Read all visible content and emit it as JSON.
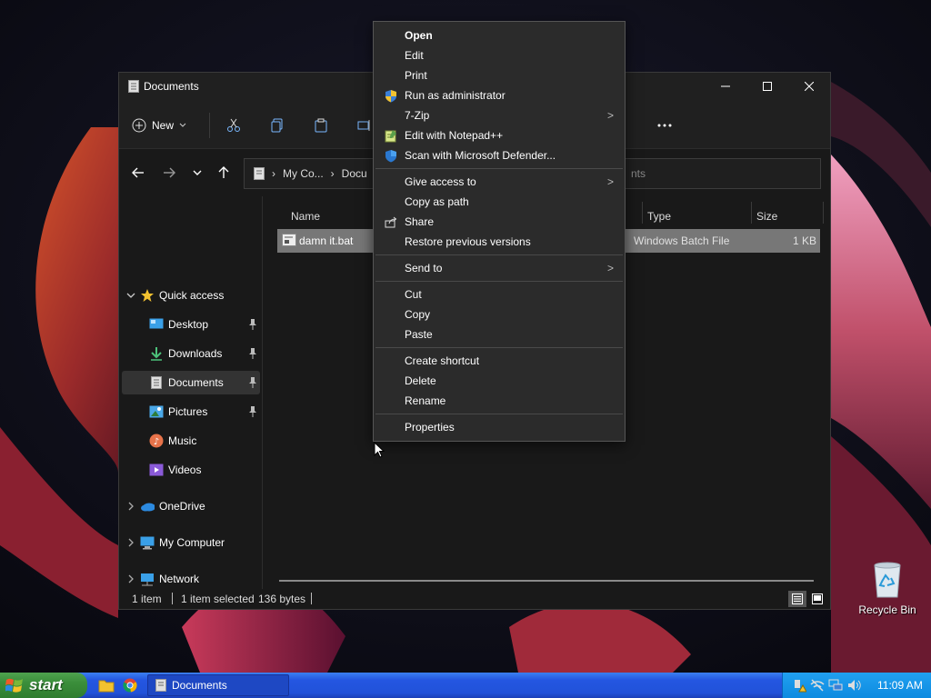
{
  "window": {
    "title": "Documents",
    "new_label": "New",
    "breadcrumb": [
      "My Co...",
      "Docu"
    ],
    "search_placeholder": "nts",
    "nav_items": [
      {
        "label": "Quick access",
        "icon": "star-icon"
      },
      {
        "label": "Desktop",
        "icon": "desktop-icon",
        "pinned": true
      },
      {
        "label": "Downloads",
        "icon": "download-icon",
        "pinned": true
      },
      {
        "label": "Documents",
        "icon": "document-icon",
        "pinned": true,
        "selected": true
      },
      {
        "label": "Pictures",
        "icon": "picture-icon",
        "pinned": true
      },
      {
        "label": "Music",
        "icon": "music-icon"
      },
      {
        "label": "Videos",
        "icon": "video-icon"
      },
      {
        "label": "OneDrive",
        "icon": "cloud-icon"
      },
      {
        "label": "My Computer",
        "icon": "computer-icon"
      },
      {
        "label": "Network",
        "icon": "network-icon"
      }
    ],
    "columns": {
      "name": "Name",
      "type": "Type",
      "size": "Size"
    },
    "files": [
      {
        "name": "damn it.bat",
        "type": "Windows Batch File",
        "size": "1 KB"
      }
    ],
    "status": {
      "items": "1 item",
      "selected": "1 item selected",
      "bytes": "136 bytes"
    }
  },
  "context_menu": {
    "groups": [
      [
        {
          "label": "Open",
          "bold": true
        },
        {
          "label": "Edit"
        },
        {
          "label": "Print"
        },
        {
          "label": "Run as administrator",
          "icon": "shield-icon"
        },
        {
          "label": "7-Zip",
          "submenu": true
        },
        {
          "label": "Edit with Notepad++",
          "icon": "notepad-icon"
        },
        {
          "label": "Scan with Microsoft Defender...",
          "icon": "defender-icon"
        }
      ],
      [
        {
          "label": "Give access to",
          "submenu": true
        },
        {
          "label": "Copy as path"
        },
        {
          "label": "Share",
          "icon": "share-icon"
        },
        {
          "label": "Restore previous versions"
        }
      ],
      [
        {
          "label": "Send to",
          "submenu": true
        }
      ],
      [
        {
          "label": "Cut"
        },
        {
          "label": "Copy"
        },
        {
          "label": "Paste"
        }
      ],
      [
        {
          "label": "Create shortcut"
        },
        {
          "label": "Delete"
        },
        {
          "label": "Rename"
        }
      ],
      [
        {
          "label": "Properties"
        }
      ]
    ],
    "submenu_glyph": ">"
  },
  "desktop": {
    "recycle_bin_label": "Recycle Bin"
  },
  "taskbar": {
    "start_label": "start",
    "task_label": "Documents",
    "clock": "11:09 AM"
  },
  "colors": {
    "selection": "#777777",
    "accent_taskbar": "#2456e1",
    "start_green": "#3b8e3b"
  }
}
